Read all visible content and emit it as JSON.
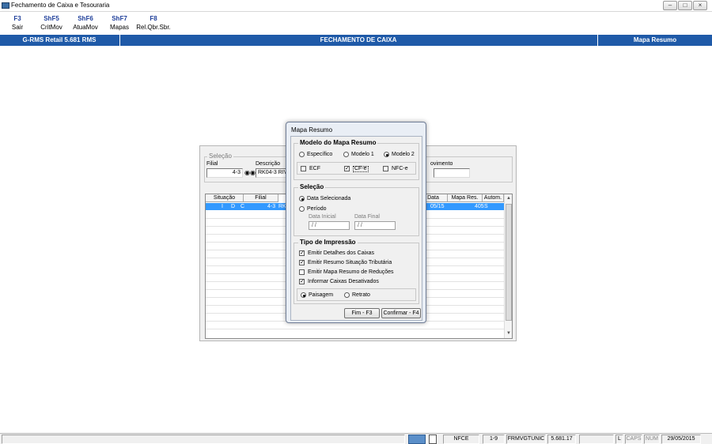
{
  "window": {
    "title": "Fechamento de Caixa e Tesouraria",
    "controls": [
      "minimize-icon",
      "maximize-icon",
      "close-icon"
    ]
  },
  "function_keys": [
    {
      "key": "F3",
      "label": "Sair"
    },
    {
      "key": "ShF5",
      "label": "CritMov"
    },
    {
      "key": "ShF6",
      "label": "AtuaMov"
    },
    {
      "key": "ShF7",
      "label": "Mapas"
    },
    {
      "key": "F8",
      "label": "Rel.Qbr.Sbr."
    }
  ],
  "header": {
    "app": "G-RMS Retail 5.681 RMS",
    "screen": "FECHAMENTO DE CAIXA",
    "context": "Mapa Resumo",
    "color": "#1f5aa8"
  },
  "background_form": {
    "selecao_title": "Seleção",
    "filial_label": "Filial",
    "filial_value": "4-3",
    "descricao_label": "Descrição",
    "descricao_value": "RK04-3 RIVIE",
    "movimento_label": "ovimento",
    "movimento_value": "",
    "grid": {
      "headers": {
        "situacao": "Situação",
        "filial": "Filial",
        "data": "Data",
        "mapa": "Mapa Res.",
        "autom": "Autom."
      },
      "selected_row": {
        "s1": "I",
        "s2": "D",
        "s3": "C",
        "filial": "4-3",
        "desc": "RK",
        "data": "05/15",
        "mapa": "405",
        "autom": "S"
      }
    }
  },
  "dialog": {
    "title": "Mapa Resumo",
    "modelo": {
      "title": "Modelo do Mapa Resumo",
      "options": [
        "Específico",
        "Modelo 1",
        "Modelo 2"
      ],
      "selected": "Modelo 2",
      "checks": [
        {
          "label": "ECF",
          "checked": false
        },
        {
          "label": "CF-e",
          "checked": true
        },
        {
          "label": "NFC-e",
          "checked": false
        }
      ]
    },
    "selecao": {
      "title": "Seleção",
      "option_data": "Data Selecionada",
      "option_periodo": "Período",
      "selected": "Data Selecionada",
      "data_inicial_label": "Data Inicial",
      "data_inicial_value": " / /",
      "data_final_label": "Data Final",
      "data_final_value": " / /"
    },
    "impressao": {
      "title": "Tipo de Impressão",
      "checks": [
        {
          "label": "Emitir Detalhes dos Caixas",
          "checked": true
        },
        {
          "label": "Emitir Resumo Situação Tributária",
          "checked": true
        },
        {
          "label": "Emitir Mapa Resumo de Reduções",
          "checked": false
        },
        {
          "label": "Informar Caixas Desativados",
          "checked": true
        }
      ],
      "orientation": [
        "Paisagem",
        "Retrato"
      ],
      "selected_orientation": "Paisagem"
    },
    "buttons": {
      "fim": "Fim - F3",
      "confirmar": "Confirmar - F4"
    }
  },
  "statusbar": {
    "mode": "NFCE",
    "pages": "1-9",
    "program": "FRMVGTUNIC",
    "version": "5.681.17",
    "indicator": "L",
    "caps": "CAPS",
    "num": "NUM",
    "date": "29/05/2015"
  }
}
